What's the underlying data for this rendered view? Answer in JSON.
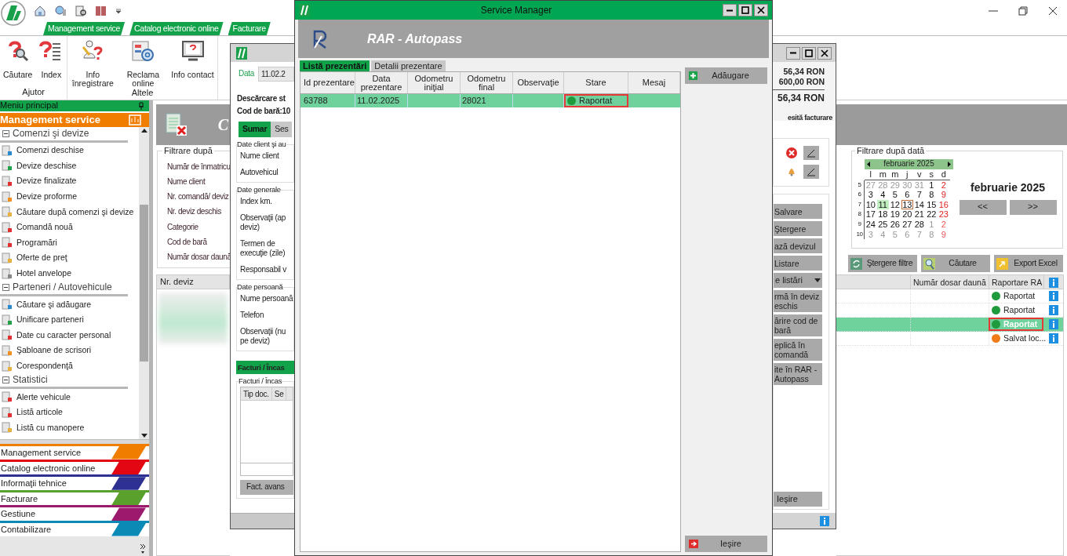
{
  "app": {
    "ribbon_tabs": [
      "Management service",
      "Catalog electronic online",
      "Facturare"
    ],
    "ribbon_groups": [
      {
        "title": "Ajutor",
        "buttons": [
          "Căutare",
          "Index"
        ]
      },
      {
        "title": "Altele",
        "buttons": [
          "Info înregistrare",
          "Reclama online",
          "Info contact"
        ]
      }
    ]
  },
  "sidebar": {
    "title": "Meniu principal",
    "active_module": "Management service",
    "sections": [
      {
        "title": "Comenzi şi devize",
        "expanded": true,
        "items": [
          "Comenzi deschise",
          "Devize deschise",
          "Devize finalizate",
          "Devize proforme",
          "Căutare după comenzi şi devize",
          "Comandă nouă",
          "Programări",
          "Oferte de preţ",
          "Hotel anvelope"
        ]
      },
      {
        "title": "Parteneri / Autovehicule",
        "expanded": true,
        "items": [
          "Căutare şi adăugare",
          "Unificare parteneri",
          "Date cu caracter personal",
          "Şabloane de scrisori",
          "Corespondenţă"
        ]
      },
      {
        "title": "Statistici",
        "expanded": true,
        "items": [
          "Alerte vehicule",
          "Listă articole",
          "Listă cu manopere"
        ]
      }
    ],
    "modules": [
      {
        "label": "Management service",
        "color": "#f07d00"
      },
      {
        "label": "Catalog electronic online",
        "color": "#e30613"
      },
      {
        "label": "Informaţii tehnice",
        "color": "#2e3192"
      },
      {
        "label": "Facturare",
        "color": "#5aa02c"
      },
      {
        "label": "Gestiune",
        "color": "#9c1a6e"
      },
      {
        "label": "Contabilizare",
        "color": "#0a8ab5"
      }
    ]
  },
  "main": {
    "title": "C",
    "filter": {
      "title": "Filtrare după",
      "labels": [
        "Număr de înmatricu",
        "Nume client",
        "Nr. comandă/ deviz",
        "Nr. deviz deschis",
        "Categorie",
        "Cod de bară",
        "Număr dosar daună"
      ]
    },
    "date_filter": {
      "title": "Filtrare după dată",
      "month": "februarie 2025",
      "week_days": [
        "l",
        "m",
        "m",
        "j",
        "v",
        "s",
        "d"
      ],
      "weeks": [
        {
          "number": "5",
          "days": [
            {
              "day": "27",
              "other_month": true,
              "sunday": false,
              "selected": false,
              "today": false
            },
            {
              "day": "28",
              "other_month": true,
              "sunday": false,
              "selected": false,
              "today": false
            },
            {
              "day": "29",
              "other_month": true,
              "sunday": false,
              "selected": false,
              "today": false
            },
            {
              "day": "30",
              "other_month": true,
              "sunday": false,
              "selected": false,
              "today": false
            },
            {
              "day": "31",
              "other_month": true,
              "sunday": false,
              "selected": false,
              "today": false
            },
            {
              "day": "1",
              "other_month": false,
              "sunday": false,
              "selected": false,
              "today": false
            },
            {
              "day": "2",
              "other_month": false,
              "sunday": true,
              "selected": false,
              "today": false
            }
          ]
        },
        {
          "number": "6",
          "days": [
            {
              "day": "3",
              "other_month": false,
              "sunday": false,
              "selected": false,
              "today": false
            },
            {
              "day": "4",
              "other_month": false,
              "sunday": false,
              "selected": false,
              "today": false
            },
            {
              "day": "5",
              "other_month": false,
              "sunday": false,
              "selected": false,
              "today": false
            },
            {
              "day": "6",
              "other_month": false,
              "sunday": false,
              "selected": false,
              "today": false
            },
            {
              "day": "7",
              "other_month": false,
              "sunday": false,
              "selected": false,
              "today": false
            },
            {
              "day": "8",
              "other_month": false,
              "sunday": false,
              "selected": false,
              "today": false
            },
            {
              "day": "9",
              "other_month": false,
              "sunday": true,
              "selected": false,
              "today": false
            }
          ]
        },
        {
          "number": "7",
          "days": [
            {
              "day": "10",
              "other_month": false,
              "sunday": false,
              "selected": false,
              "today": false
            },
            {
              "day": "11",
              "other_month": false,
              "sunday": false,
              "selected": true,
              "today": false
            },
            {
              "day": "12",
              "other_month": false,
              "sunday": false,
              "selected": false,
              "today": false
            },
            {
              "day": "13",
              "other_month": false,
              "sunday": false,
              "selected": false,
              "today": true
            },
            {
              "day": "14",
              "other_month": false,
              "sunday": false,
              "selected": false,
              "today": false
            },
            {
              "day": "15",
              "other_month": false,
              "sunday": false,
              "selected": false,
              "today": false
            },
            {
              "day": "16",
              "other_month": false,
              "sunday": true,
              "selected": false,
              "today": false
            }
          ]
        },
        {
          "number": "8",
          "days": [
            {
              "day": "17",
              "other_month": false,
              "sunday": false,
              "selected": false,
              "today": false
            },
            {
              "day": "18",
              "other_month": false,
              "sunday": false,
              "selected": false,
              "today": false
            },
            {
              "day": "19",
              "other_month": false,
              "sunday": false,
              "selected": false,
              "today": false
            },
            {
              "day": "20",
              "other_month": false,
              "sunday": false,
              "selected": false,
              "today": false
            },
            {
              "day": "21",
              "other_month": false,
              "sunday": false,
              "selected": false,
              "today": false
            },
            {
              "day": "22",
              "other_month": false,
              "sunday": false,
              "selected": false,
              "today": false
            },
            {
              "day": "23",
              "other_month": false,
              "sunday": true,
              "selected": false,
              "today": false
            }
          ]
        },
        {
          "number": "9",
          "days": [
            {
              "day": "24",
              "other_month": false,
              "sunday": false,
              "selected": false,
              "today": false
            },
            {
              "day": "25",
              "other_month": false,
              "sunday": false,
              "selected": false,
              "today": false
            },
            {
              "day": "26",
              "other_month": false,
              "sunday": false,
              "selected": false,
              "today": false
            },
            {
              "day": "27",
              "other_month": false,
              "sunday": false,
              "selected": false,
              "today": false
            },
            {
              "day": "28",
              "other_month": false,
              "sunday": false,
              "selected": false,
              "today": false
            },
            {
              "day": "1",
              "other_month": true,
              "sunday": false,
              "selected": false,
              "today": false
            },
            {
              "day": "2",
              "other_month": true,
              "sunday": true,
              "selected": false,
              "today": false
            }
          ]
        },
        {
          "number": "10",
          "days": [
            {
              "day": "3",
              "other_month": true,
              "sunday": false,
              "selected": false,
              "today": false
            },
            {
              "day": "4",
              "other_month": true,
              "sunday": false,
              "selected": false,
              "today": false
            },
            {
              "day": "5",
              "other_month": true,
              "sunday": false,
              "selected": false,
              "today": false
            },
            {
              "day": "6",
              "other_month": true,
              "sunday": false,
              "selected": false,
              "today": false
            },
            {
              "day": "7",
              "other_month": true,
              "sunday": false,
              "selected": false,
              "today": false
            },
            {
              "day": "8",
              "other_month": true,
              "sunday": false,
              "selected": false,
              "today": false
            },
            {
              "day": "9",
              "other_month": true,
              "sunday": true,
              "selected": false,
              "today": false
            }
          ]
        }
      ],
      "month_label": "februarie 2025",
      "prev_button": "<<",
      "next_button": ">>"
    },
    "actions": [
      "Ştergere filtre",
      "Căutare",
      "Export Excel"
    ],
    "table": {
      "columns": [
        "Nr. deviz",
        "Număr dosar daună",
        "Raportare RA"
      ],
      "rows": [
        {
          "status": "Raportat",
          "color": "#1f9a3c",
          "selected": false,
          "outlined": false
        },
        {
          "status": "Raportat",
          "color": "#1f9a3c",
          "selected": false,
          "outlined": false
        },
        {
          "status": "Raportat",
          "color": "#1f9a3c",
          "selected": true,
          "outlined": true
        },
        {
          "status": "Salvat loc...",
          "color": "#f07c1a",
          "selected": false,
          "outlined": false
        }
      ]
    }
  },
  "estimate_window": {
    "date_label": "Data",
    "date_value": "11.02.2",
    "heading": "Descărcare st",
    "barcode": "Cod de bară:10",
    "tabs": [
      {
        "label": "Sumar",
        "selected": true
      },
      {
        "label": "Ses",
        "selected": false
      }
    ],
    "groups": [
      {
        "title": "Date client şi au",
        "fields": [
          "Nume client",
          "Autovehicul"
        ]
      },
      {
        "title": "Date generale",
        "fields": [
          "Index km.",
          "Observaţii (ap deviz)",
          "Termen de execuţie (zile)",
          "Responsabil v"
        ]
      },
      {
        "title": "Date persoană",
        "fields": [
          "Nume persoană",
          "Telefon",
          "Observaţii (nu pe deviz)"
        ]
      }
    ],
    "invoices_header": "Facturi / Încas",
    "invoices_group": "Facturi / Încas",
    "invoice_columns": [
      "Tip doc.",
      "Se"
    ],
    "advance_button": "Fact. avans",
    "amounts": [
      "56,34 RON",
      "600,00 RON"
    ],
    "total": "56,34 RON",
    "invoice_note": "esită facturare",
    "buttons": [
      {
        "label": "Salvare",
        "kind": "plain"
      },
      {
        "label": "Ştergere",
        "kind": "plain"
      },
      {
        "label": "ază devizul",
        "kind": "plain"
      },
      {
        "label": "Listare",
        "kind": "plain"
      },
      {
        "label": "e listări",
        "kind": "dropdown"
      },
      {
        "label": "rmă în deviz eschis",
        "kind": "plain"
      },
      {
        "label": "ărire cod de bară",
        "kind": "plain"
      },
      {
        "label": "eplică în comandă",
        "kind": "plain"
      },
      {
        "label": "ite în RAR - Autopass",
        "kind": "plain"
      }
    ],
    "exit_button": "Ieşire"
  },
  "service_manager": {
    "title": "Service Manager",
    "header": "RAR - Autopass",
    "tabs": [
      {
        "label": "Listă prezentări",
        "selected": true
      },
      {
        "label": "Detalii prezentare",
        "selected": false
      }
    ],
    "columns": [
      "Id prezentare",
      "Data prezentare",
      "Odometru iniţial",
      "Odometru final",
      "Observaţie",
      "Stare",
      "Mesaj"
    ],
    "rows": [
      {
        "id": "63788",
        "date": "11.02.2025",
        "odometer_final": "28021",
        "status": "Raportat",
        "color": "#1f9a3c",
        "selected": true,
        "outlined": true
      }
    ],
    "add_button": "Adăugare",
    "exit_button": "Ieşire"
  }
}
